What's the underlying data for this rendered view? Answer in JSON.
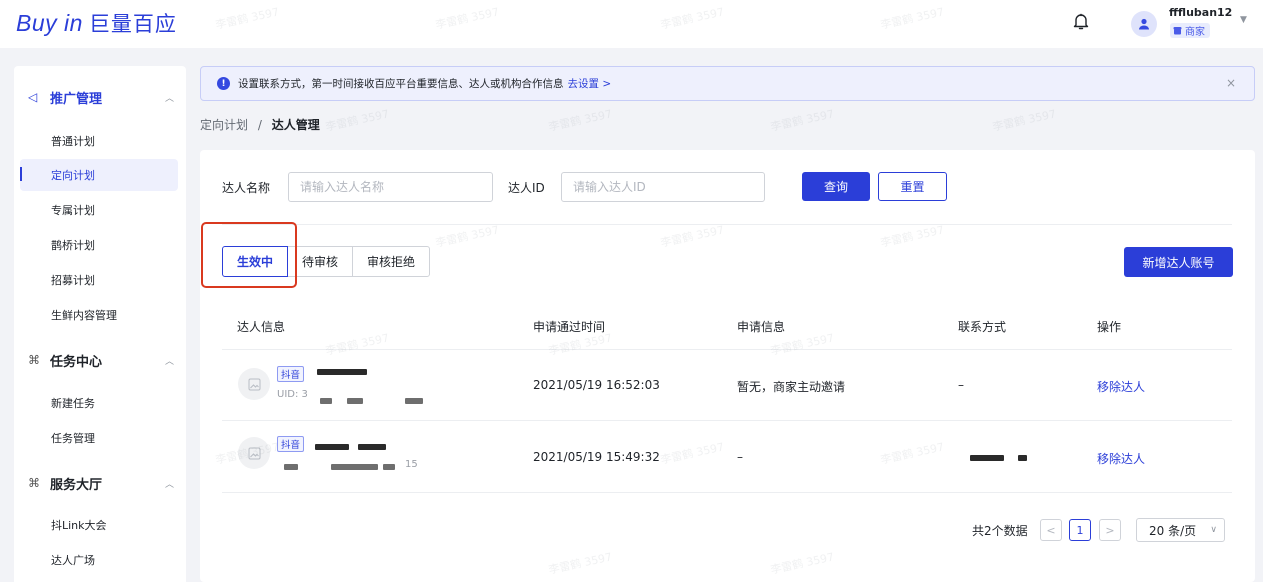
{
  "header": {
    "logo_latin": "Buy in",
    "logo_cn": "巨量百应",
    "username": "fffluban12",
    "role": "商家",
    "icons": {
      "bell": "bell-icon",
      "avatar": "user-avatar-icon",
      "caret": "caret-down-icon"
    }
  },
  "sidebar": {
    "sections": [
      {
        "label": "推广管理",
        "icon": "megaphone-icon"
      },
      {
        "label": "任务中心",
        "icon": "grid-icon"
      },
      {
        "label": "服务大厅",
        "icon": "grid-icon"
      }
    ],
    "items": [
      {
        "label": "普通计划"
      },
      {
        "label": "定向计划"
      },
      {
        "label": "专属计划"
      },
      {
        "label": "鹊桥计划"
      },
      {
        "label": "招募计划"
      },
      {
        "label": "生鲜内容管理"
      },
      {
        "label": "新建任务"
      },
      {
        "label": "任务管理"
      },
      {
        "label": "抖Link大会"
      },
      {
        "label": "达人广场"
      }
    ]
  },
  "notice": {
    "text": "设置联系方式，第一时间接收百应平台重要信息、达人或机构合作信息",
    "link": "去设置 >",
    "close": "×"
  },
  "breadcrumb": {
    "parent": "定向计划",
    "sep": "/",
    "current": "达人管理"
  },
  "filters": {
    "name_label": "达人名称",
    "name_placeholder": "请输入达人名称",
    "id_label": "达人ID",
    "id_placeholder": "请输入达人ID",
    "query": "查询",
    "reset": "重置"
  },
  "tabs": [
    {
      "label": "生效中",
      "active": true
    },
    {
      "label": "待审核"
    },
    {
      "label": "审核拒绝"
    }
  ],
  "add_button": "新增达人账号",
  "table": {
    "columns": [
      "达人信息",
      "申请通过时间",
      "申请信息",
      "联系方式",
      "操作"
    ],
    "rows": [
      {
        "platform": "抖音",
        "id_prefix": "UID: 3",
        "time": "2021/05/19 16:52:03",
        "info": "暂无，商家主动邀请",
        "contact": "–",
        "action": "移除达人"
      },
      {
        "platform": "抖音",
        "id_suffix": "15",
        "time": "2021/05/19 15:49:32",
        "info": "–",
        "contact": "",
        "action": "移除达人"
      }
    ]
  },
  "pagination": {
    "total": "共2个数据",
    "prev": "<",
    "page": "1",
    "next": ">",
    "size": "20 条/页",
    "size_caret": "∨"
  },
  "watermark": "李雷鹤 3597",
  "colors": {
    "accent": "#2b3ed8",
    "highlight": "#d9391f"
  }
}
